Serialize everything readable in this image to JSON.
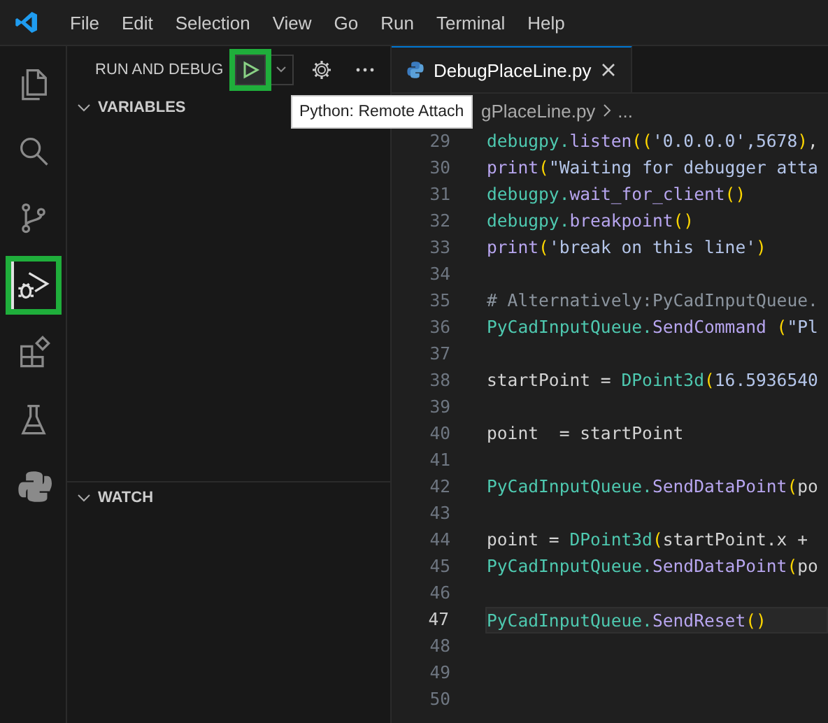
{
  "menu": [
    "File",
    "Edit",
    "Selection",
    "View",
    "Go",
    "Run",
    "Terminal",
    "Help"
  ],
  "activity_bar": [
    {
      "kind": "files",
      "selected": false,
      "highlighted": false
    },
    {
      "kind": "search",
      "selected": false,
      "highlighted": false
    },
    {
      "kind": "source-control",
      "selected": false,
      "highlighted": false
    },
    {
      "kind": "run-debug",
      "selected": true,
      "highlighted": true
    },
    {
      "kind": "extensions",
      "selected": false,
      "highlighted": false
    },
    {
      "kind": "testing",
      "selected": false,
      "highlighted": false
    },
    {
      "kind": "python",
      "selected": false,
      "highlighted": false
    }
  ],
  "sidebar": {
    "title": "RUN AND DEBUG",
    "start_button": {
      "highlighted": true
    },
    "tooltip": "Python: Remote Attach",
    "sections": [
      {
        "label": "VARIABLES",
        "expanded": true
      },
      {
        "label": "WATCH",
        "expanded": true
      }
    ]
  },
  "editor": {
    "tabs": [
      {
        "label": "DebugPlaceLine.py",
        "selected": true
      }
    ],
    "breadcrumb": [
      "gPlaceLine.py",
      "..."
    ],
    "lines": [
      {
        "number": "29",
        "current": false,
        "tokens": [
          {
            "kind": "module",
            "text": "debugpy."
          },
          {
            "kind": "method",
            "text": "listen"
          },
          {
            "kind": "paren",
            "text": "(("
          },
          {
            "kind": "string",
            "text": "'0.0.0.0',5678"
          },
          {
            "kind": "paren",
            "text": ")"
          },
          {
            "kind": "plain",
            "text": ","
          }
        ]
      },
      {
        "number": "30",
        "current": false,
        "tokens": [
          {
            "kind": "method",
            "text": "print"
          },
          {
            "kind": "paren",
            "text": "("
          },
          {
            "kind": "string",
            "text": "\"Waiting for debugger atta"
          }
        ]
      },
      {
        "number": "31",
        "current": false,
        "tokens": [
          {
            "kind": "module",
            "text": "debugpy."
          },
          {
            "kind": "method",
            "text": "wait_for_client"
          },
          {
            "kind": "paren",
            "text": "()"
          }
        ]
      },
      {
        "number": "32",
        "current": false,
        "tokens": [
          {
            "kind": "module",
            "text": "debugpy."
          },
          {
            "kind": "method",
            "text": "breakpoint"
          },
          {
            "kind": "paren",
            "text": "()"
          }
        ]
      },
      {
        "number": "33",
        "current": false,
        "tokens": [
          {
            "kind": "method",
            "text": "print"
          },
          {
            "kind": "paren",
            "text": "("
          },
          {
            "kind": "string",
            "text": "'break on this line'"
          },
          {
            "kind": "paren",
            "text": ")"
          }
        ]
      },
      {
        "number": "34",
        "current": false
      },
      {
        "number": "35",
        "current": false,
        "tokens": [
          {
            "kind": "comment",
            "text": "# Alternatively:PyCadInputQueue."
          }
        ]
      },
      {
        "number": "36",
        "current": false,
        "tokens": [
          {
            "kind": "module",
            "text": "PyCadInputQueue."
          },
          {
            "kind": "method",
            "text": "SendCommand"
          },
          {
            "kind": "paren",
            "text": " ("
          },
          {
            "kind": "string",
            "text": "\"Pl"
          }
        ]
      },
      {
        "number": "37",
        "current": false
      },
      {
        "number": "38",
        "current": false,
        "tokens": [
          {
            "kind": "plain",
            "text": "startPoint = "
          },
          {
            "kind": "module",
            "text": "DPoint3d"
          },
          {
            "kind": "paren",
            "text": "("
          },
          {
            "kind": "string",
            "text": "16.5936540"
          }
        ]
      },
      {
        "number": "39",
        "current": false
      },
      {
        "number": "40",
        "current": false,
        "tokens": [
          {
            "kind": "plain",
            "text": "point  = startPoint"
          }
        ]
      },
      {
        "number": "41",
        "current": false
      },
      {
        "number": "42",
        "current": false,
        "tokens": [
          {
            "kind": "module",
            "text": "PyCadInputQueue."
          },
          {
            "kind": "method",
            "text": "SendDataPoint"
          },
          {
            "kind": "paren",
            "text": "("
          },
          {
            "kind": "plain",
            "text": "po"
          }
        ]
      },
      {
        "number": "43",
        "current": false
      },
      {
        "number": "44",
        "current": false,
        "tokens": [
          {
            "kind": "plain",
            "text": "point = "
          },
          {
            "kind": "module",
            "text": "DPoint3d"
          },
          {
            "kind": "paren",
            "text": "("
          },
          {
            "kind": "plain",
            "text": "startPoint.x +"
          }
        ]
      },
      {
        "number": "45",
        "current": false,
        "tokens": [
          {
            "kind": "module",
            "text": "PyCadInputQueue."
          },
          {
            "kind": "method",
            "text": "SendDataPoint"
          },
          {
            "kind": "paren",
            "text": "("
          },
          {
            "kind": "plain",
            "text": "po"
          }
        ]
      },
      {
        "number": "46",
        "current": false
      },
      {
        "number": "47",
        "current": true,
        "tokens": [
          {
            "kind": "module",
            "text": "PyCadInputQueue."
          },
          {
            "kind": "method",
            "text": "SendReset"
          },
          {
            "kind": "paren",
            "text": "()"
          }
        ]
      },
      {
        "number": "48",
        "current": false
      },
      {
        "number": "49",
        "current": false
      },
      {
        "number": "50",
        "current": false
      }
    ]
  }
}
